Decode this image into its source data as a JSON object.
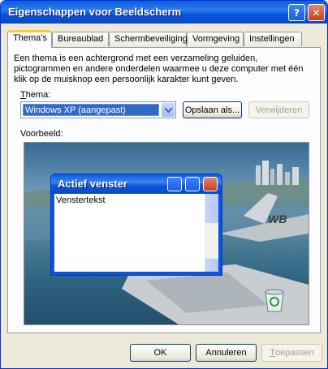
{
  "window": {
    "title": "Eigenschappen voor Beeldscherm"
  },
  "tabs": [
    {
      "label": "Thema's",
      "active": true
    },
    {
      "label": "Bureaublad"
    },
    {
      "label": "Schermbeveiliging"
    },
    {
      "label": "Vormgeving"
    },
    {
      "label": "Instellingen"
    }
  ],
  "description": "Een thema is een achtergrond met een verzameling geluiden, pictogrammen en andere onderdelen waarmee u deze computer met één klik op de muisknop een persoonlijk karakter kunt geven.",
  "theme": {
    "label_prefix": "T",
    "label_rest": "hema:",
    "selected": "Windows XP (aangepast)",
    "save_label": "Opslaan als...",
    "delete_label": "Verwijderen"
  },
  "preview": {
    "label": "Voorbeeld:",
    "window_title": "Actief venster",
    "window_text": "Venstertekst",
    "tail_text": "WB"
  },
  "footer": {
    "ok_label": "OK",
    "cancel_label": "Annuleren",
    "apply_prefix": "T",
    "apply_rest": "oepassen"
  }
}
